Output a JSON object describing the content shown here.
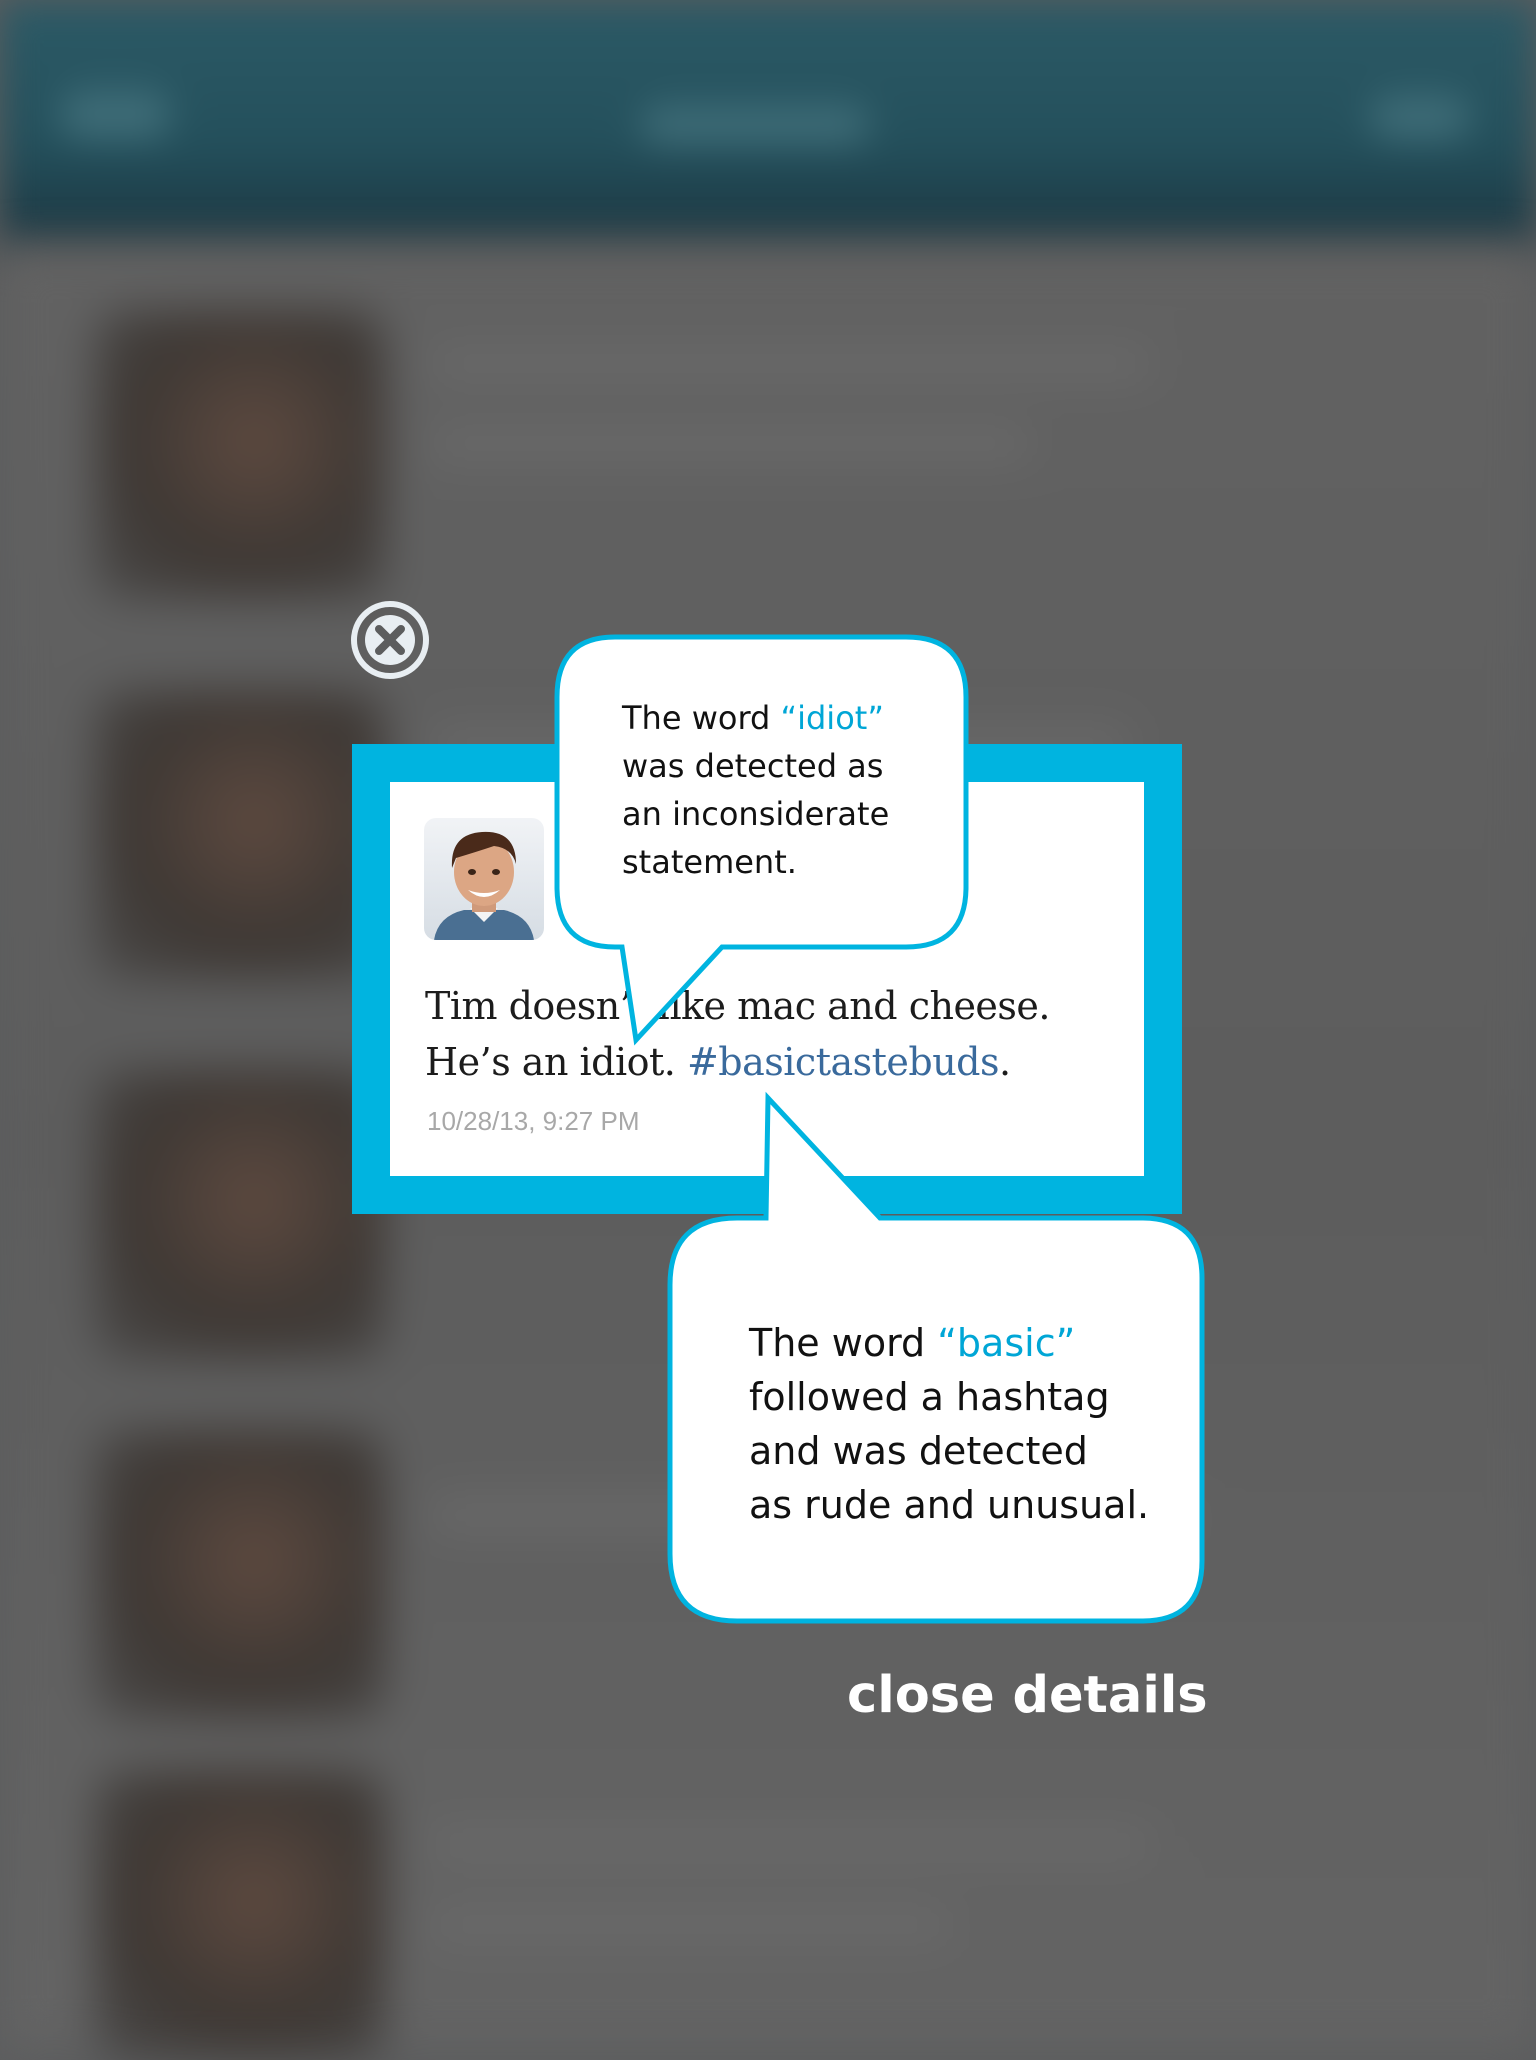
{
  "tweet": {
    "text_line1": "Tim doesn’t like mac and cheese.",
    "text_line2_prefix": "He’s an idiot. ",
    "hashtag": "#basictastebuds",
    "text_line2_suffix": ".",
    "timestamp": "10/28/13, 9:27 PM"
  },
  "callout_top": {
    "line1_prefix": "The word ",
    "highlight": "“idiot”",
    "line2": "was detected as",
    "line3": "an inconsiderate",
    "line4": "statement."
  },
  "callout_bottom": {
    "line1_prefix": "The word ",
    "highlight": "“basic”",
    "line2": "followed a hashtag",
    "line3": "and was detected",
    "line4": "as rude and unusual."
  },
  "actions": {
    "close_details": "close details"
  },
  "colors": {
    "accent": "#00b4e0",
    "highlight": "#00a6d6",
    "hashtag": "#3a6a9c",
    "overlay_bg": "#5c5d5e"
  },
  "icons": {
    "close": "close-circle-icon",
    "avatar": "user-avatar"
  }
}
